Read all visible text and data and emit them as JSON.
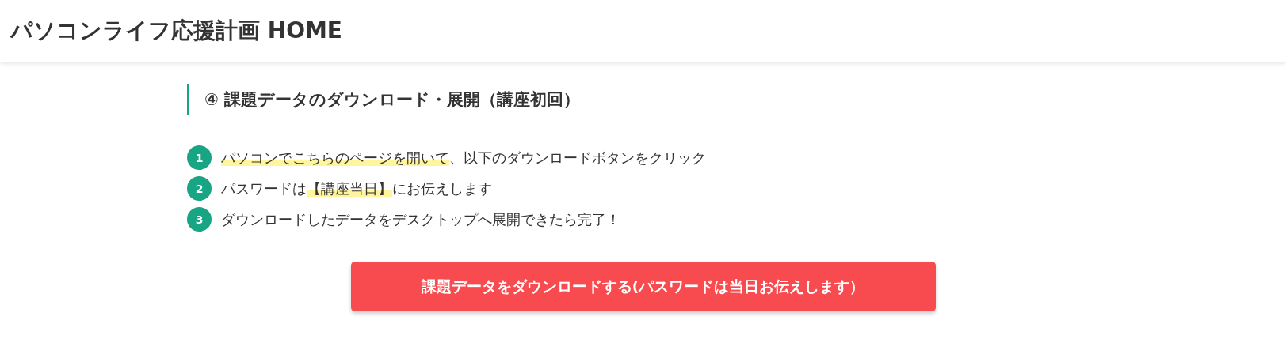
{
  "header": {
    "title": "パソコンライフ応援計画 HOME"
  },
  "section": {
    "heading": "④ 課題データのダウンロード・展開（講座初回）",
    "steps": [
      {
        "number": "1",
        "segments": [
          {
            "text": "パソコンでこちらのページを開いて",
            "highlight": true
          },
          {
            "text": "、以下のダウンロードボタンをクリック",
            "highlight": false
          }
        ]
      },
      {
        "number": "2",
        "segments": [
          {
            "text": "パスワードは",
            "highlight": false
          },
          {
            "text": "【講座当日】",
            "highlight": true
          },
          {
            "text": "にお伝えします",
            "highlight": false
          }
        ]
      },
      {
        "number": "3",
        "segments": [
          {
            "text": "ダウンロードしたデータをデスクトップへ展開できたら完了！",
            "highlight": false
          }
        ]
      }
    ],
    "button": {
      "label": "課題データをダウンロードする(パスワードは当日お伝えします）"
    }
  }
}
